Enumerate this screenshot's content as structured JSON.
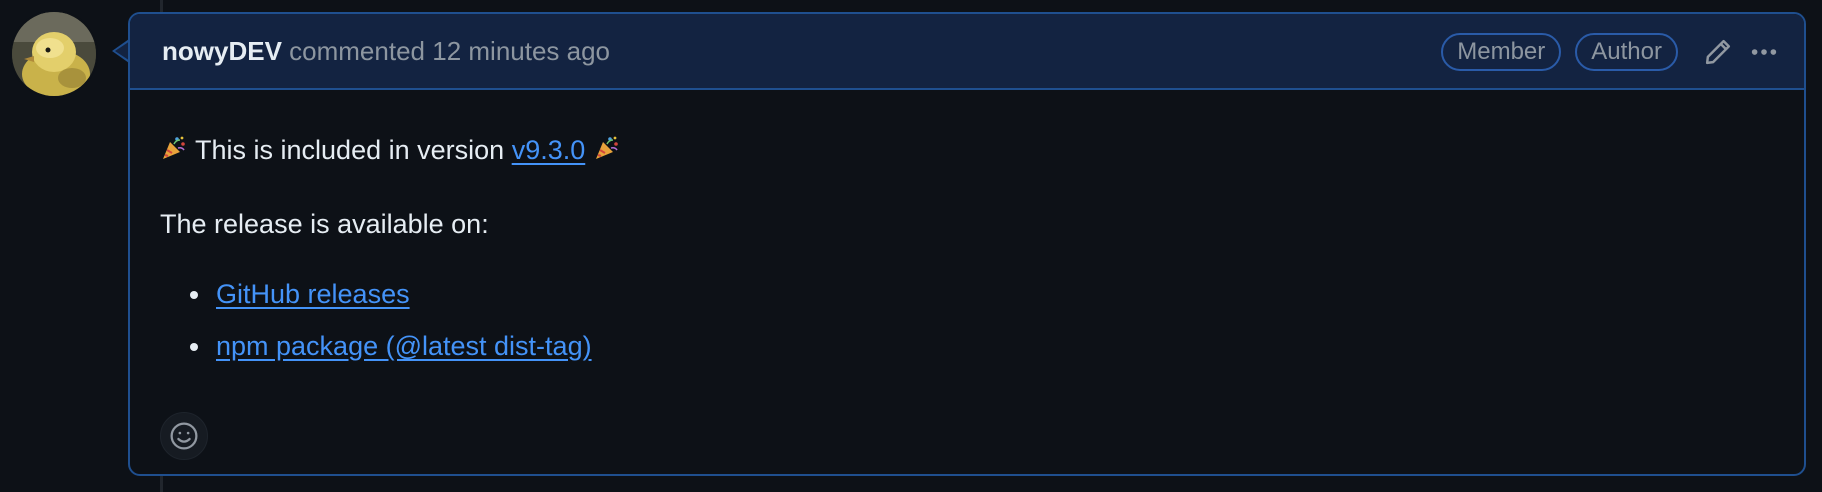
{
  "comment": {
    "author": "nowyDEV",
    "action": "commented",
    "timestamp": "12 minutes ago",
    "badges": [
      "Member",
      "Author"
    ],
    "actions": {
      "edit_icon": "pencil-icon",
      "more_icon": "kebab-horizontal-icon"
    },
    "avatar_icon": "duckling-avatar"
  },
  "body": {
    "line1_prefix": "This is included in version",
    "version_link": "v9.3.0",
    "emoji": "party-popper",
    "line2": "The release is available on:",
    "links": [
      {
        "label": "GitHub releases"
      },
      {
        "label": "npm package (@latest dist-tag)"
      }
    ]
  },
  "reactions": {
    "add_icon": "smiley-icon"
  },
  "colors": {
    "background": "#0d1117",
    "header_bg": "#132341",
    "border": "#1f4f8f",
    "text": "#e6edf3",
    "muted": "#8d96a0",
    "link": "#4493f8"
  }
}
